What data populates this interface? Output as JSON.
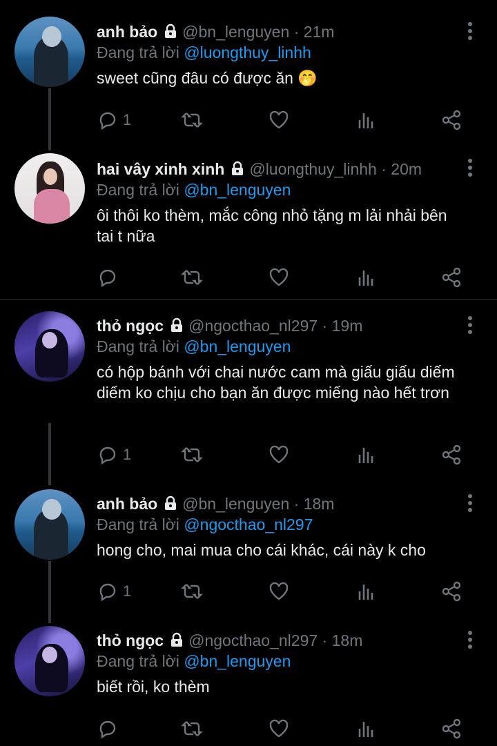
{
  "reply_prefix": "Đang trả lời",
  "tweets": [
    {
      "name": "anh bảo",
      "handle": "@bn_lenguyen",
      "sep": "·",
      "time": "21m",
      "reply_to": "@luongthuy_linhh",
      "text": "sweet cũng đâu có được ăn 🤭",
      "reply_count": "1",
      "avatar": "sea"
    },
    {
      "name": "hai vây xinh xinh",
      "handle": "@luongthuy_linhh",
      "sep": "·",
      "time": "20m",
      "reply_to": "@bn_lenguyen",
      "text": "ôi thôi ko thèm, mắc công nhỏ tặng m lải nhải bên tai t nữa",
      "reply_count": "",
      "avatar": "pink"
    },
    {
      "name": "thỏ ngọc",
      "handle": "@ngocthao_nl297",
      "sep": "·",
      "time": "19m",
      "reply_to": "@bn_lenguyen",
      "text": "có hộp bánh với chai nước cam mà giấu giấu diếm diếm ko chịu cho bạn ăn được miếng nào hết trơn",
      "reply_count": "1",
      "avatar": "purple"
    },
    {
      "name": "anh bảo",
      "handle": "@bn_lenguyen",
      "sep": "·",
      "time": "18m",
      "reply_to": "@ngocthao_nl297",
      "text": "hong cho, mai mua cho cái khác, cái này k cho",
      "reply_count": "1",
      "avatar": "sea"
    },
    {
      "name": "thỏ ngọc",
      "handle": "@ngocthao_nl297",
      "sep": "·",
      "time": "18m",
      "reply_to": "@bn_lenguyen",
      "text": "biết rồi, ko thèm",
      "reply_count": "",
      "avatar": "purple"
    }
  ],
  "icons": {
    "lock": "lock-icon",
    "more": "more-vertical-icon",
    "reply": "reply-icon",
    "retweet": "retweet-icon",
    "like": "heart-icon",
    "analytics": "analytics-icon",
    "share": "share-icon"
  },
  "colors": {
    "background": "#000000",
    "text": "#e7e9ea",
    "muted": "#71767b",
    "link": "#1d9bf0"
  }
}
